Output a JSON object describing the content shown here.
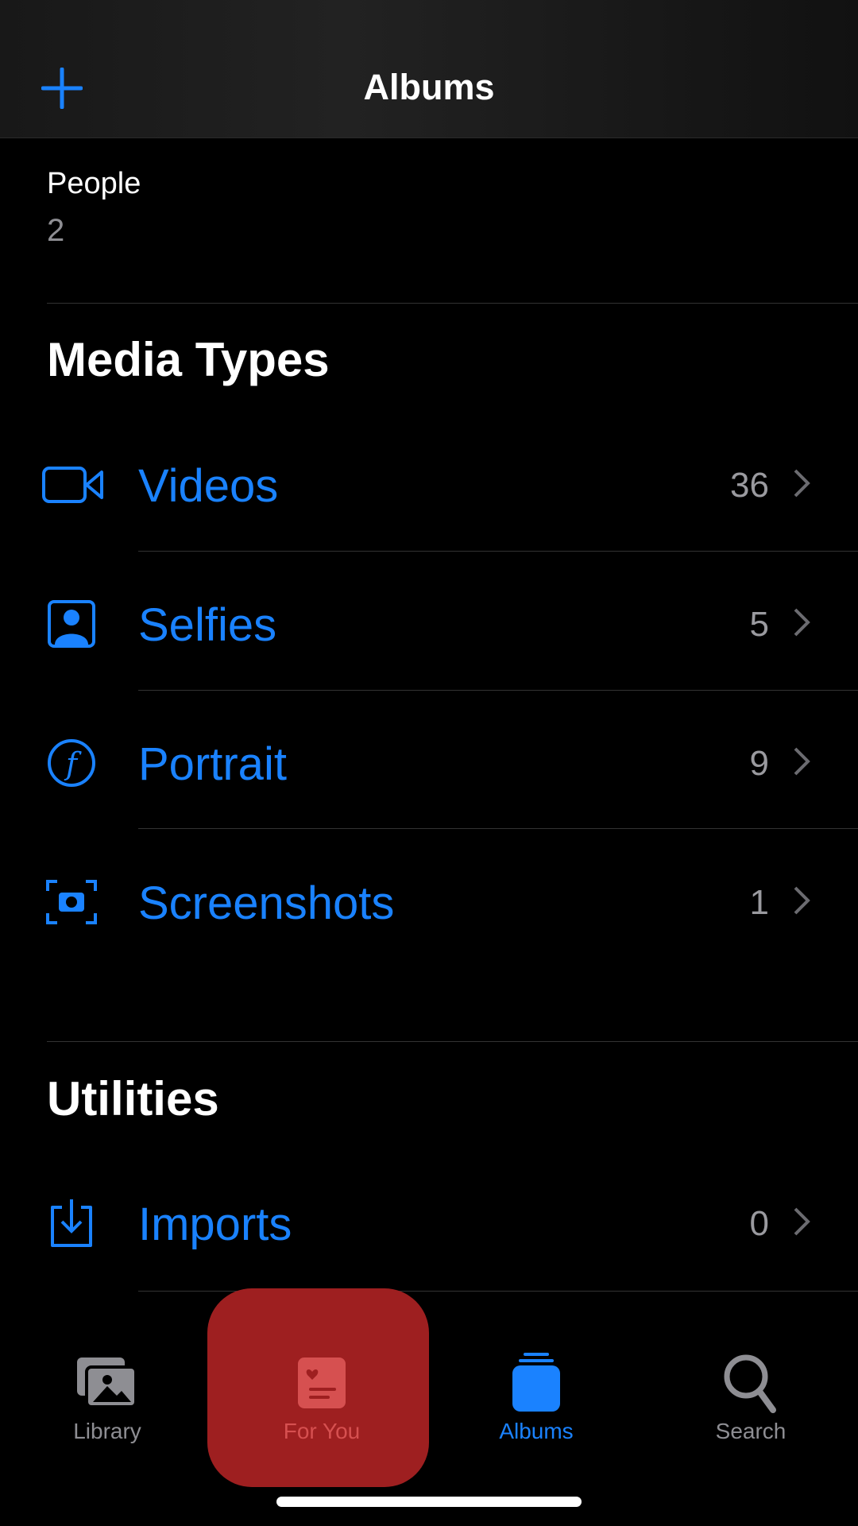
{
  "header": {
    "title": "Albums",
    "add_icon": "plus-icon"
  },
  "people": {
    "label": "People",
    "count": "2"
  },
  "media_types": {
    "title": "Media Types",
    "items": [
      {
        "label": "Videos",
        "count": "36",
        "icon": "video-icon"
      },
      {
        "label": "Selfies",
        "count": "5",
        "icon": "selfie-icon"
      },
      {
        "label": "Portrait",
        "count": "9",
        "icon": "portrait-icon"
      },
      {
        "label": "Screenshots",
        "count": "1",
        "icon": "screenshot-icon"
      }
    ]
  },
  "utilities": {
    "title": "Utilities",
    "items": [
      {
        "label": "Imports",
        "count": "0",
        "icon": "import-icon"
      }
    ]
  },
  "tabbar": {
    "items": [
      {
        "label": "Library",
        "icon": "photo-library-icon"
      },
      {
        "label": "For You",
        "icon": "for-you-icon"
      },
      {
        "label": "Albums",
        "icon": "albums-icon",
        "selected": true
      },
      {
        "label": "Search",
        "icon": "search-icon"
      }
    ]
  },
  "colors": {
    "accent": "#1a82ff",
    "highlight": "#9e1f20",
    "inactive": "#8e8e93"
  }
}
